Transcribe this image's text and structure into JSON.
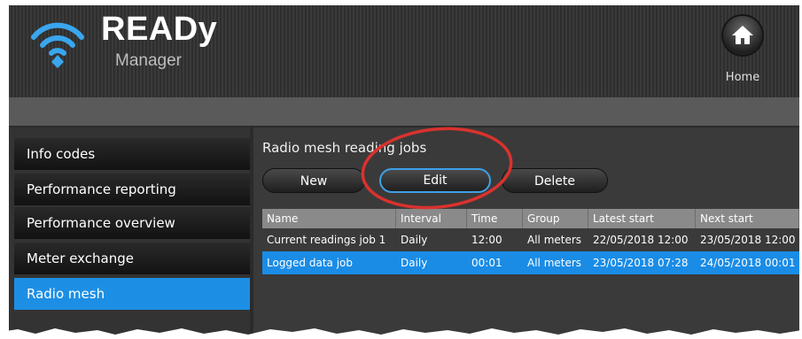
{
  "app": {
    "brand_title": "READy",
    "brand_subtitle": "Manager",
    "home_label": "Home"
  },
  "sidebar": {
    "items": [
      {
        "label": "Info codes"
      },
      {
        "label": "Performance reporting"
      },
      {
        "label": "Performance overview"
      },
      {
        "label": "Meter exchange"
      },
      {
        "label": "Radio mesh",
        "active": true
      }
    ]
  },
  "main": {
    "title": "Radio mesh reading jobs",
    "buttons": {
      "new": "New",
      "edit": "Edit",
      "delete": "Delete"
    },
    "table": {
      "columns": [
        "Name",
        "Interval",
        "Time",
        "Group",
        "Latest start",
        "Next start"
      ],
      "rows": [
        [
          "Current readings job 1",
          "Daily",
          "12:00",
          "All meters",
          "22/05/2018 12:00",
          "23/05/2018 12:00"
        ],
        [
          "Logged data job",
          "Daily",
          "00:01",
          "All meters",
          "23/05/2018 07:28",
          "24/05/2018 00:01"
        ]
      ],
      "selected_row": 1
    }
  },
  "colors": {
    "accent": "#1c8fe4",
    "annotation": "#d9322e"
  },
  "icons": [
    "wifi-logo-icon",
    "home-icon"
  ]
}
